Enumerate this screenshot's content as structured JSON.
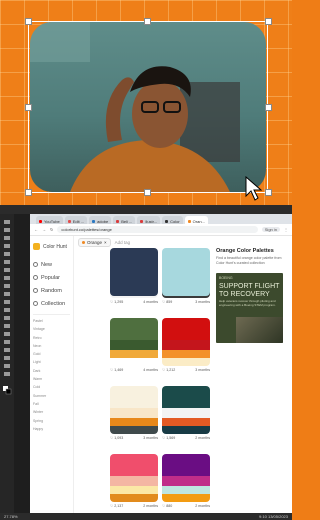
{
  "browser": {
    "tabs": [
      {
        "label": "YouTube",
        "color": "#ff0000"
      },
      {
        "label": "Edit ...",
        "color": "#e34d4d"
      },
      {
        "label": "adobe",
        "color": "#2b79c2"
      },
      {
        "label": "Beli ...",
        "color": "#d93c3c"
      },
      {
        "label": "Ilustr...",
        "color": "#d93c3c"
      },
      {
        "label": "Color",
        "color": "#333333"
      },
      {
        "label": "Oran...",
        "color": "#f08a24",
        "active": true
      }
    ],
    "url": "colorhunt.co/palettes/orange",
    "sign_in": "Sign in"
  },
  "site": {
    "logo": "Color Hunt",
    "nav": [
      {
        "label": "New",
        "icon": "new-icon"
      },
      {
        "label": "Popular",
        "icon": "popular-icon"
      },
      {
        "label": "Random",
        "icon": "random-icon"
      },
      {
        "label": "Collection",
        "icon": "collection-icon"
      }
    ],
    "tags": [
      "Pastel",
      "Vintage",
      "Retro",
      "Neon",
      "Gold",
      "Light",
      "Dark",
      "Warm",
      "Cold",
      "Summer",
      "Fall",
      "Winter",
      "Spring",
      "Happy"
    ],
    "search": {
      "chip": "Orange",
      "placeholder": "Add tag"
    },
    "info": {
      "title": "Orange Color Palettes",
      "text": "Find a beautiful orange color palette from Color Hunt's curated collection"
    },
    "ad": {
      "brand": "BOEING",
      "headline": "SUPPORT FLIGHT TO RECOVERY",
      "body": "Help veterans recover through piloting and engineering with a Boeing STEM program."
    },
    "palettes": [
      {
        "colors": [
          "#1f3b57",
          "#fc5185",
          "#e79b3e",
          "#f3f3f3"
        ],
        "likes": "1,295",
        "age": "4 months"
      },
      {
        "colors": [
          "#f9e8d9",
          "#f7b881",
          "#f0742e",
          "#3a3a3a"
        ],
        "likes": "859",
        "age": "3 months"
      },
      {
        "colors": [
          "#4f6f3f",
          "#3a5a2f",
          "#f0a93a",
          "#ffffff"
        ],
        "likes": "1,469",
        "age": "4 months"
      },
      {
        "colors": [
          "#d20f0f",
          "#c4151c",
          "#f3912a",
          "#fbecc6"
        ],
        "likes": "1,212",
        "age": "3 months"
      },
      {
        "colors": [
          "#f8f1df",
          "#f8e6c8",
          "#e8881a",
          "#3f4a4c"
        ],
        "likes": "1,093",
        "age": "3 months"
      },
      {
        "colors": [
          "#1b4b4a",
          "#f3f3f3",
          "#e35a24",
          "#183b45"
        ],
        "likes": "1,569",
        "age": "2 months"
      },
      {
        "colors": [
          "#f04e6c",
          "#f4b6a3",
          "#fbe8a6",
          "#e28b1d"
        ],
        "likes": "2,137",
        "age": "2 months"
      },
      {
        "colors": [
          "#6a0d83",
          "#c02d89",
          "#bfe6e0",
          "#f39c12"
        ],
        "likes": "880",
        "age": "2 months"
      },
      {
        "colors": [
          "#2b3a55",
          "#2b3a55",
          "#2b3a55",
          "#2b3a55"
        ],
        "likes": "",
        "age": ""
      },
      {
        "colors": [
          "#a7d8de",
          "#a7d8de",
          "#a7d8de",
          "#a7d8de"
        ],
        "likes": "",
        "age": ""
      }
    ]
  },
  "taskbar": {
    "time": "9:10",
    "date": "13/05/2023"
  },
  "status": {
    "zoom": "27.78%"
  }
}
